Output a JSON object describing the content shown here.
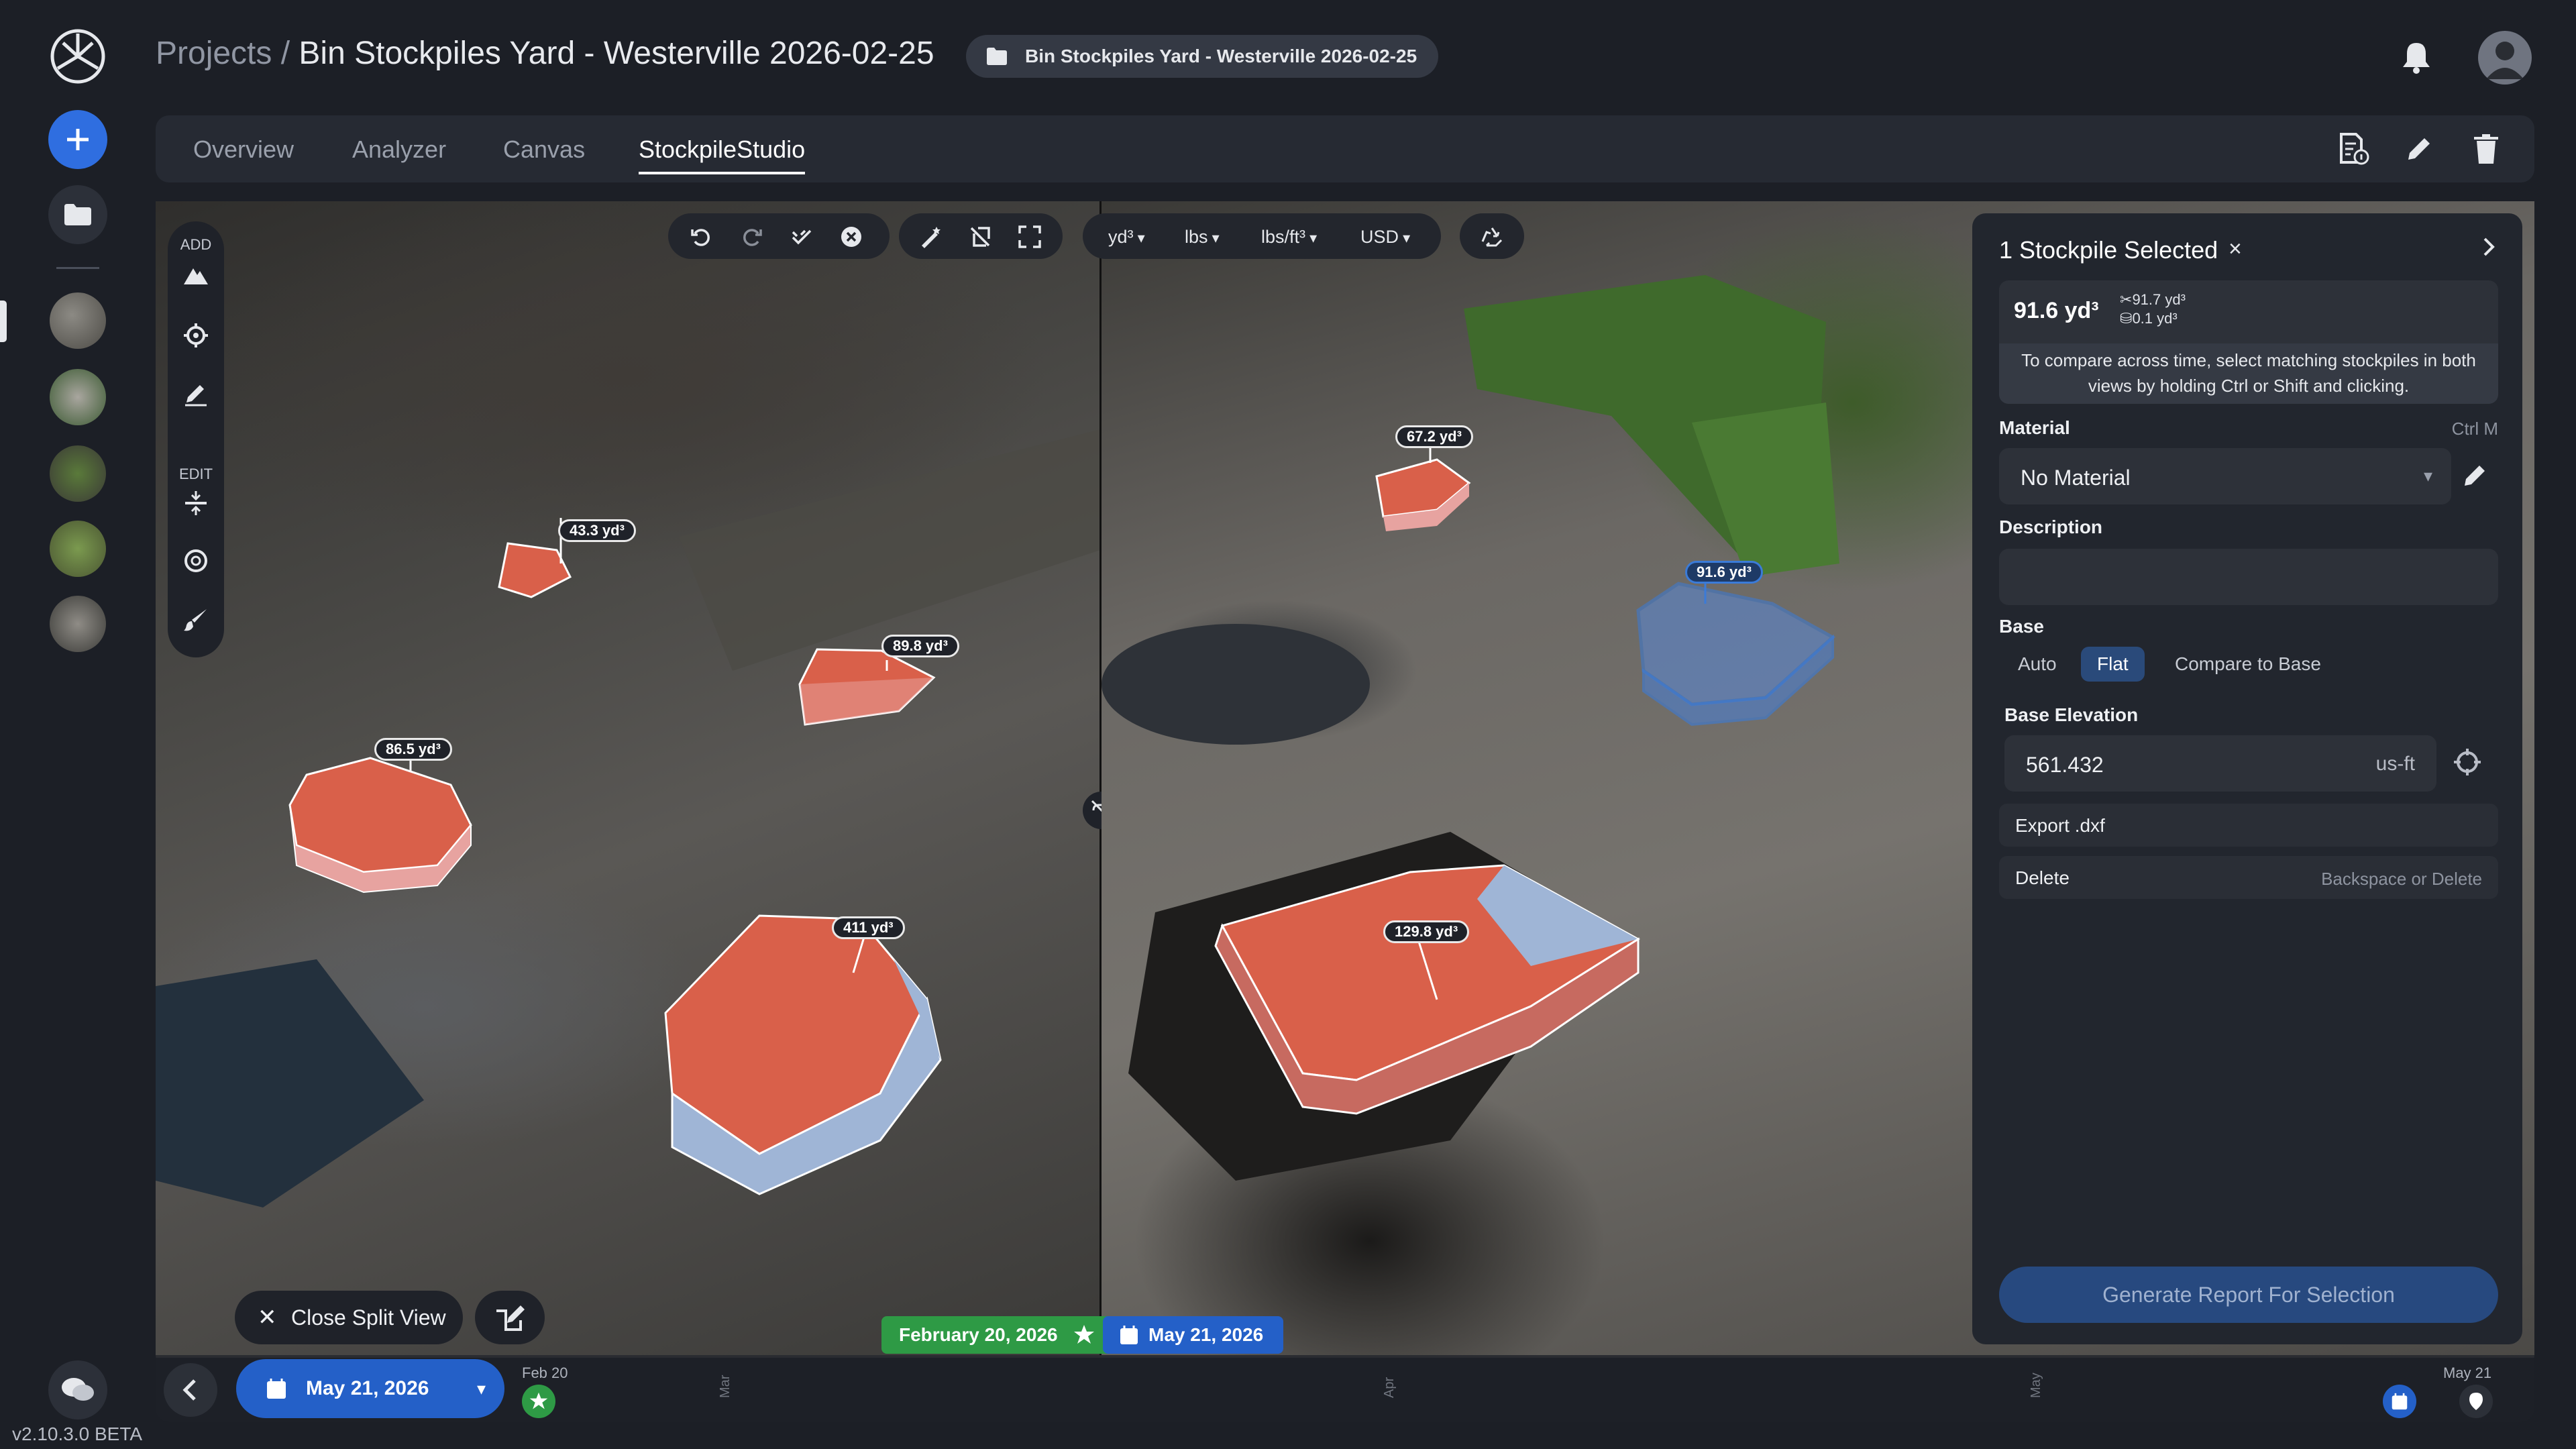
{
  "app": {
    "version": "v2.10.3.0 BETA"
  },
  "header": {
    "breadcrumb_root": "Projects",
    "breadcrumb_sep": " / ",
    "title": "Bin Stockpiles Yard - Westerville 2026-02-25",
    "project_badge": "Bin Stockpiles Yard - Westerville 2026-02-25"
  },
  "tabs": [
    {
      "label": "Overview"
    },
    {
      "label": "Analyzer"
    },
    {
      "label": "Canvas"
    },
    {
      "label": "StockpileStudio"
    }
  ],
  "tools": {
    "add_label": "ADD",
    "edit_label": "EDIT"
  },
  "units": {
    "volume": "yd³",
    "weight": "lbs",
    "density": "lbs/ft³",
    "currency": "USD"
  },
  "left_view": {
    "stockpiles": [
      {
        "label": "43.3 yd³"
      },
      {
        "label": "89.8 yd³"
      },
      {
        "label": "86.5 yd³"
      },
      {
        "label": "411 yd³"
      }
    ]
  },
  "right_view": {
    "stockpiles": [
      {
        "label": "67.2 yd³"
      },
      {
        "label": "91.6 yd³",
        "selected": true
      },
      {
        "label": "129.8 yd³"
      }
    ]
  },
  "panel": {
    "title": "1 Stockpile Selected",
    "close": "×",
    "volume": "91.6 yd³",
    "cut": "91.7 yd³",
    "fill": "0.1 yd³",
    "hint": "To compare across time, select matching stockpiles in both views by holding Ctrl or Shift and clicking.",
    "material_label": "Material",
    "material_shortcut": "Ctrl M",
    "material_value": "No Material",
    "description_label": "Description",
    "description_value": "",
    "base_label": "Base",
    "base_options": [
      "Auto",
      "Flat",
      "Compare to Base"
    ],
    "base_selected": "Flat",
    "base_elevation_label": "Base Elevation",
    "base_elevation_value": "561.432",
    "base_elevation_unit": "us-ft",
    "export_label": "Export .dxf",
    "delete_label": "Delete",
    "delete_hint": "Backspace or Delete",
    "generate_label": "Generate Report For Selection"
  },
  "bottom": {
    "close_split": "Close Split View",
    "left_date": "February 20, 2026",
    "right_date": "May 21, 2026"
  },
  "timeline": {
    "current_date": "May 21, 2026",
    "start_label": "Feb 20",
    "end_label": "May 21",
    "months": [
      "Mar",
      "Apr",
      "May"
    ]
  },
  "colors": {
    "accent_blue": "#2460c8",
    "green_date": "#2e9a45",
    "stockpile_fill": "#d9604a",
    "selected_outline": "#3b7bd8"
  }
}
